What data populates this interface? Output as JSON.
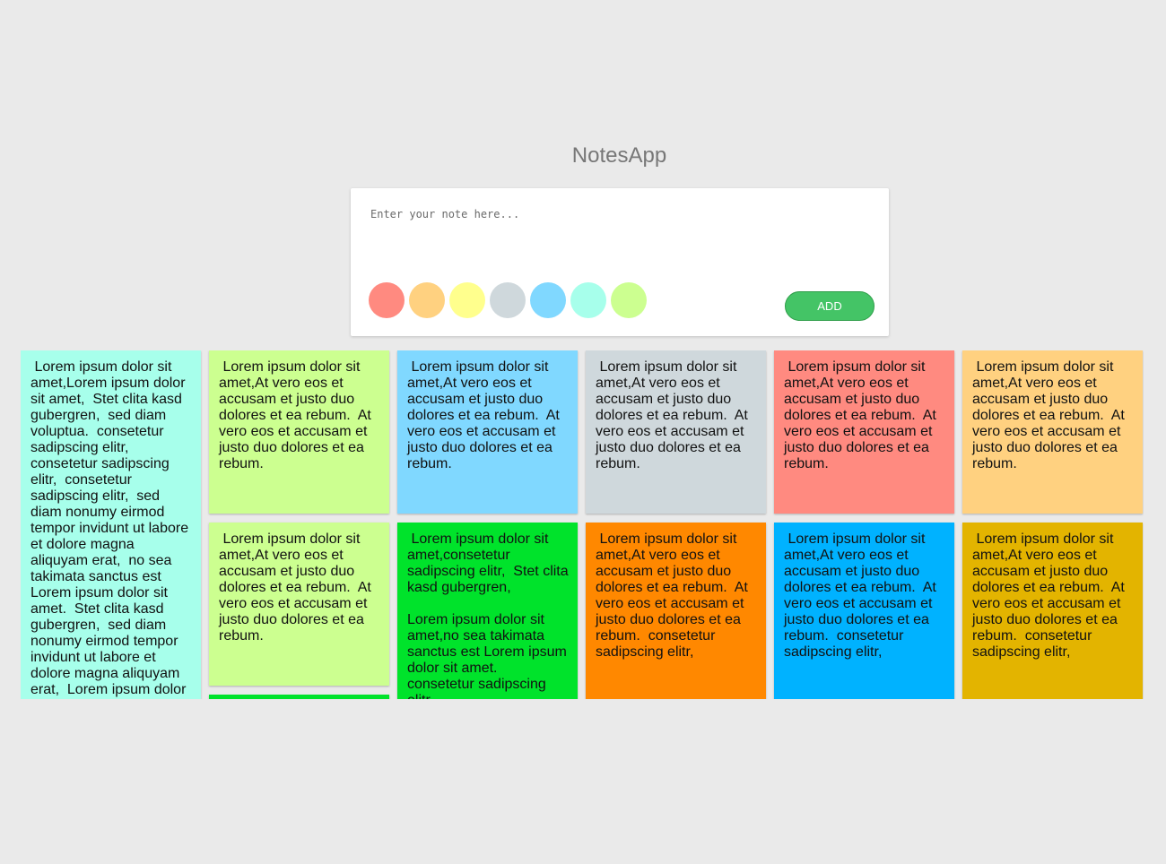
{
  "app": {
    "title": "NotesApp"
  },
  "composer": {
    "placeholder": "Enter your note here...",
    "add_label": "ADD",
    "add_color": "#44c466",
    "swatches": [
      "#ff8a80",
      "#ffd180",
      "#ffff8d",
      "#cfd8dc",
      "#80d8ff",
      "#a7ffeb",
      "#ccff90"
    ]
  },
  "notes": [
    {
      "color": "#a7ffeb",
      "text": " Lorem ipsum dolor sit amet,Lorem ipsum dolor sit amet,  Stet clita kasd gubergren,  sed diam voluptua.  consetetur sadipscing elitr,  consetetur sadipscing elitr,  consetetur sadipscing elitr,  sed diam nonumy eirmod tempor invidunt ut labore et dolore magna aliquyam erat,  no sea takimata sanctus est Lorem ipsum dolor sit amet.  Stet clita kasd gubergren,  sed diam nonumy eirmod tempor invidunt ut labore et dolore magna aliquyam erat,  Lorem ipsum dolor sit amet."
    },
    {
      "color": "#ccff90",
      "text": " Lorem ipsum dolor sit amet,At vero eos et accusam et justo duo dolores et ea rebum.  At vero eos et accusam et justo duo dolores et ea rebum."
    },
    {
      "color": "#80d8ff",
      "text": " Lorem ipsum dolor sit amet,At vero eos et accusam et justo duo dolores et ea rebum.  At vero eos et accusam et justo duo dolores et ea rebum."
    },
    {
      "color": "#cfd8dc",
      "text": " Lorem ipsum dolor sit amet,At vero eos et accusam et justo duo dolores et ea rebum.  At vero eos et accusam et justo duo dolores et ea rebum."
    },
    {
      "color": "#ff8a80",
      "text": " Lorem ipsum dolor sit amet,At vero eos et accusam et justo duo dolores et ea rebum.  At vero eos et accusam et justo duo dolores et ea rebum."
    },
    {
      "color": "#ffd180",
      "text": " Lorem ipsum dolor sit amet,At vero eos et accusam et justo duo dolores et ea rebum.  At vero eos et accusam et justo duo dolores et ea rebum."
    },
    {
      "color": "#ccff90",
      "text": " Lorem ipsum dolor sit amet,At vero eos et accusam et justo duo dolores et ea rebum.  At vero eos et accusam et justo duo dolores et ea rebum."
    },
    {
      "color": "#00e32b",
      "text": " Lorem ipsum dolor sit amet,consetetur sadipscing elitr,  Stet clita kasd gubergren,\n\nLorem ipsum dolor sit amet,no sea takimata sanctus est Lorem ipsum dolor sit amet.  consetetur sadipscing elitr,"
    },
    {
      "color": "#ff8800",
      "text": " Lorem ipsum dolor sit amet,At vero eos et accusam et justo duo dolores et ea rebum.  At vero eos et accusam et justo duo dolores et ea rebum.  consetetur sadipscing elitr,"
    },
    {
      "color": "#00b2ff",
      "text": " Lorem ipsum dolor sit amet,At vero eos et accusam et justo duo dolores et ea rebum.  At vero eos et accusam et justo duo dolores et ea rebum.  consetetur sadipscing elitr,"
    },
    {
      "color": "#e3b400",
      "text": " Lorem ipsum dolor sit amet,At vero eos et accusam et justo duo dolores et ea rebum.  At vero eos et accusam et justo duo dolores et ea rebum.  consetetur sadipscing elitr,"
    },
    {
      "color": "#00e32b",
      "text": ""
    }
  ]
}
